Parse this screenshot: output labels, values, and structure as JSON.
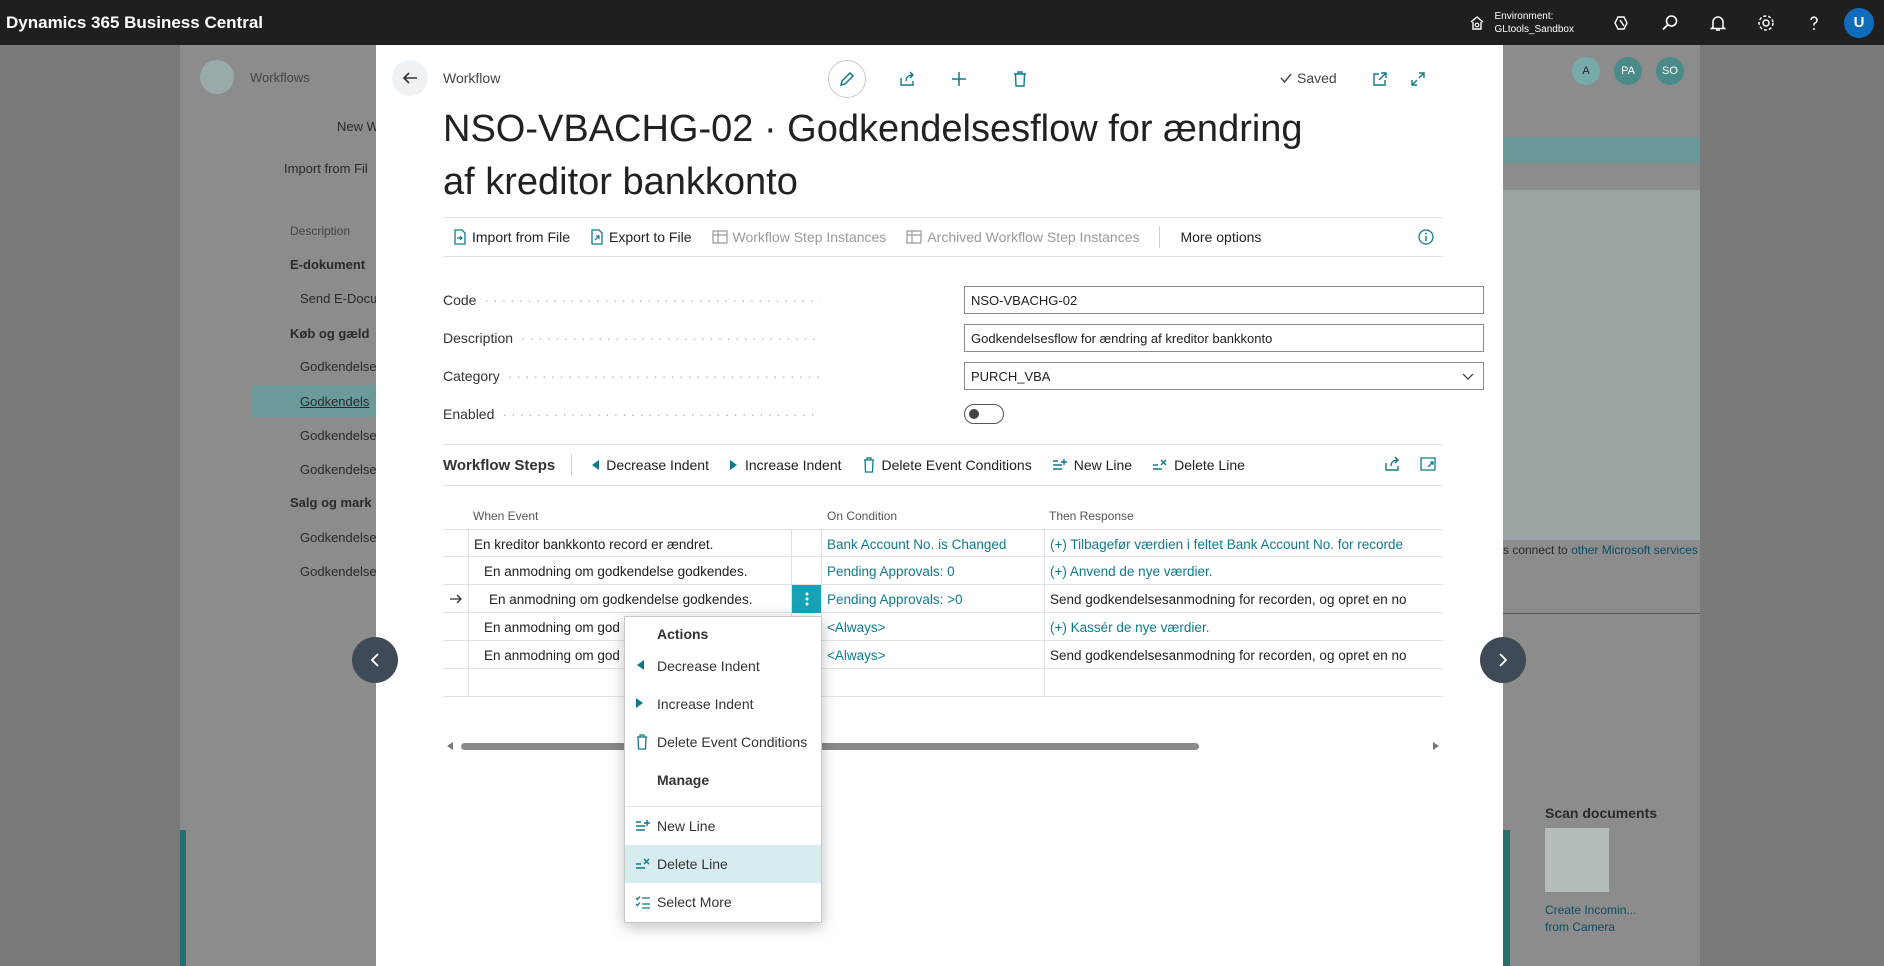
{
  "app": {
    "title": "Dynamics 365 Business Central",
    "environment_label": "Environment:",
    "environment_value": "GLtools_Sandbox",
    "user_initial": "U"
  },
  "background": {
    "breadcrumb": "Workflows",
    "new_label": "New W",
    "import_label": "Import from Fil",
    "column": "Description",
    "groups": [
      "E-dokument",
      "Køb og gæld",
      "Salg og mark"
    ],
    "rows": [
      "Send E-Docu",
      "Godkendelse",
      "Godkendels",
      "Godkendelse",
      "Godkendelse",
      "Godkendelse",
      "Godkendelse"
    ],
    "connect_text": "s connect to",
    "connect_link": "other Microsoft services",
    "scan_title": "Scan documents",
    "scan_caption_1": "Create Incomin...",
    "scan_caption_2": "from Camera",
    "avatars": [
      "A",
      "PA",
      "SO"
    ]
  },
  "dialog": {
    "breadcrumb": "Workflow",
    "saved": "Saved",
    "title": "NSO-VBACHG-02 · Godkendelsesflow for ændring af kreditor bankkonto",
    "actions": {
      "import": "Import from File",
      "export": "Export to File",
      "step_instances": "Workflow Step Instances",
      "archived": "Archived Workflow Step Instances",
      "more": "More options"
    },
    "fields": {
      "code_label": "Code",
      "code_value": "NSO-VBACHG-02",
      "desc_label": "Description",
      "desc_value": "Godkendelsesflow for ændring af kreditor bankkonto",
      "cat_label": "Category",
      "cat_value": "PURCH_VBA",
      "enabled_label": "Enabled",
      "enabled": false
    },
    "steps": {
      "title": "Workflow Steps",
      "decrease": "Decrease Indent",
      "increase": "Increase Indent",
      "delete_conditions": "Delete Event Conditions",
      "new_line": "New Line",
      "delete_line": "Delete Line",
      "columns": {
        "event": "When Event",
        "condition": "On Condition",
        "response": "Then Response"
      },
      "rows": [
        {
          "event": "En kreditor bankkonto record er ændret.",
          "condition": "Bank Account No. is Changed",
          "response": "(+) Tilbagefør værdien i feltet Bank Account No. for recorde"
        },
        {
          "event": "En anmodning om godkendelse godkendes.",
          "condition": "Pending Approvals: 0",
          "response": "(+) Anvend de nye værdier."
        },
        {
          "event": "En anmodning om godkendelse godkendes.",
          "condition": "Pending Approvals: >0",
          "response": "Send godkendelsesanmodning for recorden, og opret en no"
        },
        {
          "event": "En anmodning om god",
          "condition": "<Always>",
          "response": "(+) Kassér de nye værdier."
        },
        {
          "event": "En anmodning om god",
          "condition": "<Always>",
          "response": "Send godkendelsesanmodning for recorden, og opret en no"
        }
      ]
    }
  },
  "context_menu": {
    "actions_heading": "Actions",
    "decrease": "Decrease Indent",
    "increase": "Increase Indent",
    "delete_conditions": "Delete Event Conditions",
    "manage_heading": "Manage",
    "new_line": "New Line",
    "delete_line": "Delete Line",
    "select_more": "Select More"
  },
  "colors": {
    "accent": "#0f7a8a",
    "topbar": "#1f1f1f",
    "highlight": "#d7ecee"
  }
}
